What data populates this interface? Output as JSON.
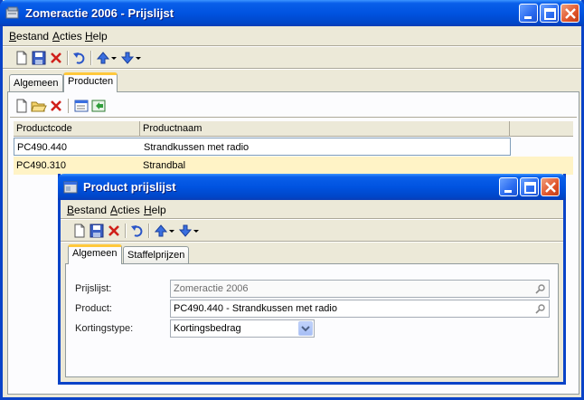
{
  "main_window": {
    "title": "Zomeractie 2006 - Prijslijst",
    "menu": [
      {
        "key": "B",
        "rest": "estand"
      },
      {
        "key": "A",
        "rest": "cties"
      },
      {
        "key": "H",
        "rest": "elp"
      }
    ],
    "tabs": [
      "Algemeen",
      "Producten"
    ],
    "active_tab": "Producten",
    "grid": {
      "columns": [
        "Productcode",
        "Productnaam"
      ],
      "rows": [
        {
          "code": "PC490.440",
          "name": "Strandkussen met radio"
        },
        {
          "code": "PC490.310",
          "name": "Strandbal"
        }
      ]
    }
  },
  "dialog": {
    "title": "Product prijslijst",
    "menu": [
      {
        "key": "B",
        "rest": "estand"
      },
      {
        "key": "A",
        "rest": "cties"
      },
      {
        "key": "H",
        "rest": "elp"
      }
    ],
    "tabs": [
      "Algemeen",
      "Staffelprijzen"
    ],
    "active_tab": "Algemeen",
    "fields": {
      "prijslijst": {
        "label": "Prijslijst:",
        "value": "Zomeractie 2006"
      },
      "product": {
        "label": "Product:",
        "value": "PC490.440 - Strandkussen met radio"
      },
      "kortingstype": {
        "label": "Kortingstype:",
        "value": "Kortingsbedrag"
      }
    }
  },
  "colors": {
    "titlebar": "#0053E0",
    "window_bg": "#ECE9D8",
    "selected_row": "#FFF3C6",
    "tab_highlight": "#FFC83C"
  }
}
